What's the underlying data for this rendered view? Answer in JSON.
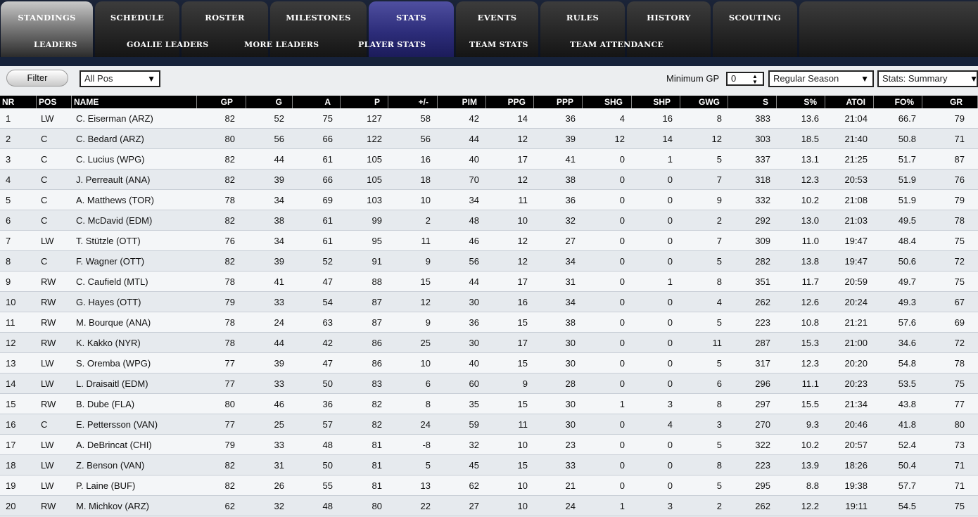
{
  "nav": {
    "tabs": [
      "STANDINGS",
      "SCHEDULE",
      "ROSTER",
      "MILESTONES",
      "STATS",
      "EVENTS",
      "RULES",
      "HISTORY",
      "SCOUTING"
    ],
    "subtabs": [
      "LEADERS",
      "GOALIE LEADERS",
      "MORE LEADERS",
      "PLAYER STATS",
      "TEAM STATS",
      "TEAM ATTENDANCE"
    ]
  },
  "toolbar": {
    "filter_label": "Filter",
    "position_select": "All Pos",
    "min_gp_label": "Minimum GP",
    "min_gp_value": "0",
    "season_select": "Regular Season",
    "stats_select": "Stats: Summary"
  },
  "table": {
    "headers": [
      "NR",
      "POS",
      "NAME",
      "GP",
      "G",
      "A",
      "P",
      "+/-",
      "PIM",
      "PPG",
      "PPP",
      "SHG",
      "SHP",
      "GWG",
      "S",
      "S%",
      "ATOI",
      "FO%",
      "GR"
    ],
    "rows": [
      [
        "1",
        "LW",
        "C. Eiserman (ARZ)",
        "82",
        "52",
        "75",
        "127",
        "58",
        "42",
        "14",
        "36",
        "4",
        "16",
        "8",
        "383",
        "13.6",
        "21:04",
        "66.7",
        "79"
      ],
      [
        "2",
        "C",
        "C. Bedard (ARZ)",
        "80",
        "56",
        "66",
        "122",
        "56",
        "44",
        "12",
        "39",
        "12",
        "14",
        "12",
        "303",
        "18.5",
        "21:40",
        "50.8",
        "71"
      ],
      [
        "3",
        "C",
        "C. Lucius (WPG)",
        "82",
        "44",
        "61",
        "105",
        "16",
        "40",
        "17",
        "41",
        "0",
        "1",
        "5",
        "337",
        "13.1",
        "21:25",
        "51.7",
        "87"
      ],
      [
        "4",
        "C",
        "J. Perreault (ANA)",
        "82",
        "39",
        "66",
        "105",
        "18",
        "70",
        "12",
        "38",
        "0",
        "0",
        "7",
        "318",
        "12.3",
        "20:53",
        "51.9",
        "76"
      ],
      [
        "5",
        "C",
        "A. Matthews (TOR)",
        "78",
        "34",
        "69",
        "103",
        "10",
        "34",
        "11",
        "36",
        "0",
        "0",
        "9",
        "332",
        "10.2",
        "21:08",
        "51.9",
        "79"
      ],
      [
        "6",
        "C",
        "C. McDavid (EDM)",
        "82",
        "38",
        "61",
        "99",
        "2",
        "48",
        "10",
        "32",
        "0",
        "0",
        "2",
        "292",
        "13.0",
        "21:03",
        "49.5",
        "78"
      ],
      [
        "7",
        "LW",
        "T. Stützle (OTT)",
        "76",
        "34",
        "61",
        "95",
        "11",
        "46",
        "12",
        "27",
        "0",
        "0",
        "7",
        "309",
        "11.0",
        "19:47",
        "48.4",
        "75"
      ],
      [
        "8",
        "C",
        "F. Wagner (OTT)",
        "82",
        "39",
        "52",
        "91",
        "9",
        "56",
        "12",
        "34",
        "0",
        "0",
        "5",
        "282",
        "13.8",
        "19:47",
        "50.6",
        "72"
      ],
      [
        "9",
        "RW",
        "C. Caufield (MTL)",
        "78",
        "41",
        "47",
        "88",
        "15",
        "44",
        "17",
        "31",
        "0",
        "1",
        "8",
        "351",
        "11.7",
        "20:59",
        "49.7",
        "75"
      ],
      [
        "10",
        "RW",
        "G. Hayes (OTT)",
        "79",
        "33",
        "54",
        "87",
        "12",
        "30",
        "16",
        "34",
        "0",
        "0",
        "4",
        "262",
        "12.6",
        "20:24",
        "49.3",
        "67"
      ],
      [
        "11",
        "RW",
        "M. Bourque (ANA)",
        "78",
        "24",
        "63",
        "87",
        "9",
        "36",
        "15",
        "38",
        "0",
        "0",
        "5",
        "223",
        "10.8",
        "21:21",
        "57.6",
        "69"
      ],
      [
        "12",
        "RW",
        "K. Kakko (NYR)",
        "78",
        "44",
        "42",
        "86",
        "25",
        "30",
        "17",
        "30",
        "0",
        "0",
        "11",
        "287",
        "15.3",
        "21:00",
        "34.6",
        "72"
      ],
      [
        "13",
        "LW",
        "S. Oremba (WPG)",
        "77",
        "39",
        "47",
        "86",
        "10",
        "40",
        "15",
        "30",
        "0",
        "0",
        "5",
        "317",
        "12.3",
        "20:20",
        "54.8",
        "78"
      ],
      [
        "14",
        "LW",
        "L. Draisaitl (EDM)",
        "77",
        "33",
        "50",
        "83",
        "6",
        "60",
        "9",
        "28",
        "0",
        "0",
        "6",
        "296",
        "11.1",
        "20:23",
        "53.5",
        "75"
      ],
      [
        "15",
        "RW",
        "B. Dube (FLA)",
        "80",
        "46",
        "36",
        "82",
        "8",
        "35",
        "15",
        "30",
        "1",
        "3",
        "8",
        "297",
        "15.5",
        "21:34",
        "43.8",
        "77"
      ],
      [
        "16",
        "C",
        "E. Pettersson (VAN)",
        "77",
        "25",
        "57",
        "82",
        "24",
        "59",
        "11",
        "30",
        "0",
        "4",
        "3",
        "270",
        "9.3",
        "20:46",
        "41.8",
        "80"
      ],
      [
        "17",
        "LW",
        "A. DeBrincat (CHI)",
        "79",
        "33",
        "48",
        "81",
        "-8",
        "32",
        "10",
        "23",
        "0",
        "0",
        "5",
        "322",
        "10.2",
        "20:57",
        "52.4",
        "73"
      ],
      [
        "18",
        "LW",
        "Z. Benson (VAN)",
        "82",
        "31",
        "50",
        "81",
        "5",
        "45",
        "15",
        "33",
        "0",
        "0",
        "8",
        "223",
        "13.9",
        "18:26",
        "50.4",
        "71"
      ],
      [
        "19",
        "LW",
        "P. Laine (BUF)",
        "82",
        "26",
        "55",
        "81",
        "13",
        "62",
        "10",
        "21",
        "0",
        "0",
        "5",
        "295",
        "8.8",
        "19:38",
        "57.7",
        "71"
      ],
      [
        "20",
        "RW",
        "M. Michkov (ARZ)",
        "62",
        "32",
        "48",
        "80",
        "22",
        "27",
        "10",
        "24",
        "1",
        "3",
        "2",
        "262",
        "12.2",
        "19:11",
        "54.5",
        "75"
      ]
    ]
  }
}
